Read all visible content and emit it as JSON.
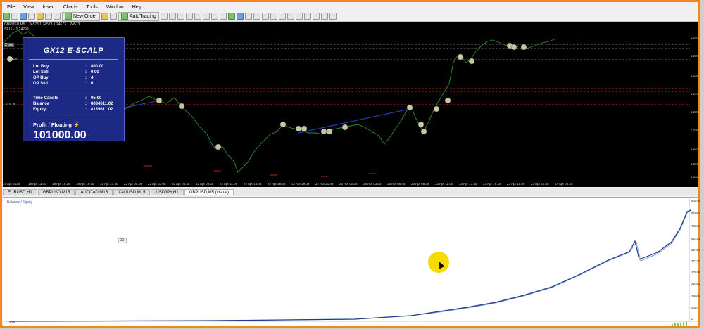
{
  "menu": [
    "File",
    "View",
    "Insert",
    "Charts",
    "Tools",
    "Window",
    "Help"
  ],
  "toolbar": {
    "new_order": "New Order",
    "autotrading": "AutoTrading"
  },
  "chart": {
    "symbol_line1": "GBPUSD,M5  1.24573 1.24573 1.24573 1.24573",
    "symbol_line2": "SELL - 1.24299",
    "left_markers": [
      "2 buy",
      "3 buy",
      "701 sl"
    ],
    "price_labels": [
      "1.240",
      "1.239",
      "1.238",
      "1.237",
      "1.236",
      "1.235",
      "1.234",
      "1.233",
      "1.232"
    ],
    "time_labels": [
      "19 Apr 2024",
      "19 Apr 13:40",
      "19 Apr 16:25",
      "19 Apr 19:05",
      "21 Apr 21:40",
      "22 Apr 00:25",
      "22 Apr 03:05",
      "22 Apr 05:45",
      "22 Apr 08:25",
      "22 Apr 11:05",
      "22 Apr 13:45",
      "22 Apr 16:25",
      "22 Apr 19:05",
      "22 Apr 21:45",
      "23 Apr 00:25",
      "23 Apr 03:05",
      "23 Apr 05:45",
      "23 Apr 08:25",
      "23 Apr 11:05",
      "23 Apr 13:45",
      "23 Apr 16:25",
      "23 Apr 19:05",
      "23 Apr 21:45",
      "24 Apr 00:25"
    ]
  },
  "panel": {
    "title": "GX12 E-SCALP",
    "rows": [
      {
        "k": "Lot Buy",
        "v": "800.00"
      },
      {
        "k": "Lot Sell",
        "v": "0.00"
      },
      {
        "k": "OP Buy",
        "v": "4"
      },
      {
        "k": "OP Sell",
        "v": "0"
      }
    ],
    "rows2": [
      {
        "k": "Time Candle",
        "v": "05:00"
      },
      {
        "k": "Balance",
        "v": "8034611.02"
      },
      {
        "k": "Equity",
        "v": "8135611.02"
      }
    ],
    "profit_label": "Profit / Floating",
    "profit_value": "101000.00"
  },
  "tabs": [
    "EURUSD,H1",
    "GBPUSD,M15",
    "AUDCAD,M15",
    "XAUUSD,M15",
    "USDJPY,H1",
    "GBPUSD,M5 (visual)"
  ],
  "tester": {
    "legend": "Balance / Equity",
    "marker_label": "32",
    "size_label": "Size",
    "y_ticks": [
      "94545",
      "85091",
      "75636",
      "66181",
      "56727",
      "47272",
      "37818",
      "28363",
      "18909",
      "9454",
      "0"
    ]
  },
  "colors": {
    "accent": "#f28a1a",
    "panel": "#1c2a85",
    "price": "#2e8b2e",
    "balance": "#1f3b8c"
  }
}
